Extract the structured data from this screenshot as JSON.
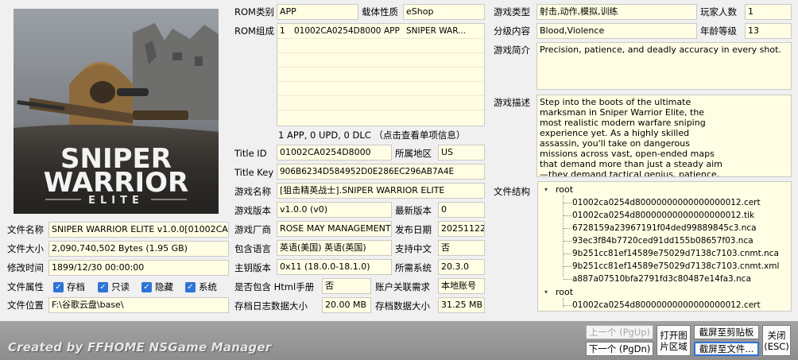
{
  "file": {
    "name_label": "文件名称",
    "name_value": "SNIPER WARRIOR ELITE v1.0.0[01002CA025",
    "size_label": "文件大小",
    "size_value": "2,090,740,502 Bytes (1.95 GB)",
    "mtime_label": "修改时间",
    "mtime_value": "1899/12/30 00:00:00",
    "attr_label": "文件属性",
    "attr_items": [
      "存档",
      "只读",
      "隐藏",
      "系统"
    ],
    "location_label": "文件位置",
    "location_value": "F:\\谷歌云盘\\base\\"
  },
  "rom": {
    "type_label": "ROM类别",
    "type_value": "APP",
    "carrier_label": "载体性质",
    "carrier_value": "eShop",
    "composition_label": "ROM组成",
    "composition_row": [
      "1",
      "01002CA0254D8000",
      "APP",
      "SNIPER WAR..."
    ],
    "summary": "1 APP, 0 UPD, 0 DLC （点击查看单项信息）",
    "titleid_label": "Title ID",
    "titleid_value": "01002CA0254D8000",
    "region_label": "所属地区",
    "region_value": "US",
    "titlekey_label": "Title Key",
    "titlekey_value": "906B6234D584952D0E286EC296AB7A4E",
    "gamename_label": "游戏名称",
    "gamename_value": "[狙击精英战士].SNIPER WARRIOR ELITE",
    "version_label": "游戏版本",
    "version_value": "v1.0.0 (v0)",
    "latest_label": "最新版本",
    "latest_value": "0",
    "publisher_label": "游戏厂商",
    "publisher_value": "ROSE MAY MANAGEMENT LTD",
    "release_label": "发布日期",
    "release_value": "20251122",
    "lang_label": "包含语言",
    "lang_value": "英语(美国) 英语(英国)",
    "cn_label": "支持中文",
    "cn_value": "否",
    "master_label": "主钥版本",
    "master_value": "0x11 (18.0.0-18.1.0)",
    "sys_label": "所需系统",
    "sys_value": "20.3.0",
    "html_label": "是否包含 Html手册",
    "html_value": "否",
    "account_label": "账户关联需求",
    "account_value": "本地账号",
    "savelog_label": "存档日志数据大小",
    "savelog_value": "20.00 MB",
    "savedata_label": "存档数据大小",
    "savedata_value": "31.25 MB"
  },
  "game": {
    "genre_label": "游戏类型",
    "genre_value": "射击,动作,模拟,训练",
    "players_label": "玩家人数",
    "players_value": "1",
    "rating_label": "分级内容",
    "rating_value": "Blood,Violence",
    "age_label": "年龄等级",
    "age_value": "13",
    "intro_label": "游戏简介",
    "intro_value": "Precision, patience, and deadly accuracy in every shot.",
    "desc_label": "游戏描述",
    "desc_value": "Step into the boots of the ultimate marksman in Sniper Warrior Elite, the most realistic modern warfare sniping experience yet. As a highly skilled assassin, you'll take on dangerous missions across vast, open-ended maps that demand more than just a steady aim—they demand tactical genius, patience, and precision.",
    "structure_label": "文件结构",
    "tree": {
      "root1": "root",
      "root1_items": [
        "01002ca0254d80000000000000000012.cert",
        "01002ca0254d80000000000000000012.tik",
        "6728159a23967191f04ded99889845c3.nca",
        "93ec3f84b7720ced91dd155b08657f03.nca",
        "9b251cc81ef14589e75029d7138c7103.cnmt.nca",
        "9b251cc81ef14589e75029d7138c7103.cnmt.xml",
        "a887a07510bfa2791fd3c80487e14fa3.nca"
      ],
      "root2": "root",
      "root2_items": [
        "01002ca0254d80000000000000000012.cert"
      ]
    }
  },
  "cover": {
    "title_line1": "SNIPER",
    "title_line2": "WARRIOR",
    "title_line3": "ELITE"
  },
  "footer": {
    "credit": "Created by FFHOME NSGame Manager",
    "prev": "上一个 (PgUp)",
    "next": "下一个 (PgDn)",
    "screenshot_area_l1": "打开图",
    "screenshot_area_l2": "片区域",
    "copy_clip": "截屏至剪贴板",
    "save_file": "截屏至文件...",
    "close_l1": "关闭",
    "close_l2": "(ESC)"
  }
}
